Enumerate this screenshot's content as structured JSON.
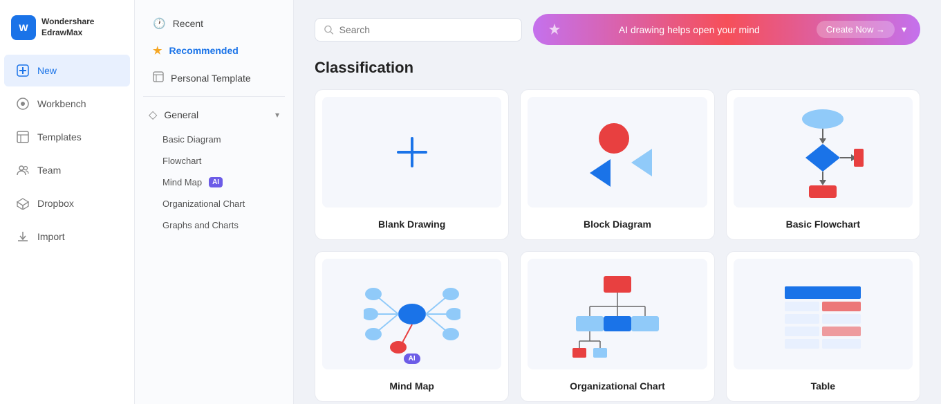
{
  "app": {
    "logo_letter": "W",
    "logo_line1": "Wondershare",
    "logo_line2": "EdrawMax"
  },
  "sidebar": {
    "items": [
      {
        "id": "new",
        "label": "New",
        "icon": "➕"
      },
      {
        "id": "workbench",
        "label": "Workbench",
        "icon": "☁"
      },
      {
        "id": "templates",
        "label": "Templates",
        "icon": "📋"
      },
      {
        "id": "team",
        "label": "Team",
        "icon": "👥"
      },
      {
        "id": "dropbox",
        "label": "Dropbox",
        "icon": "📦"
      },
      {
        "id": "import",
        "label": "Import",
        "icon": "⬇"
      }
    ]
  },
  "middle_panel": {
    "items": [
      {
        "id": "recent",
        "label": "Recent",
        "icon": "🕐",
        "active": false
      },
      {
        "id": "recommended",
        "label": "Recommended",
        "icon": "★",
        "active": true
      },
      {
        "id": "personal_template",
        "label": "Personal Template",
        "icon": "▭",
        "active": false
      }
    ],
    "sections": [
      {
        "id": "general",
        "label": "General",
        "icon": "◇",
        "expanded": true,
        "sub_items": [
          {
            "id": "basic_diagram",
            "label": "Basic Diagram",
            "ai": false
          },
          {
            "id": "flowchart",
            "label": "Flowchart",
            "ai": false
          },
          {
            "id": "mind_map",
            "label": "Mind Map",
            "ai": true
          },
          {
            "id": "org_chart",
            "label": "Organizational Chart",
            "ai": false
          },
          {
            "id": "graphs_charts",
            "label": "Graphs and Charts",
            "ai": false
          }
        ]
      }
    ]
  },
  "topbar": {
    "search_placeholder": "Search",
    "ai_banner_text": "AI drawing helps open your mind",
    "create_now_label": "Create Now →"
  },
  "main": {
    "section_title": "Classification",
    "cards": [
      {
        "id": "blank_drawing",
        "label": "Blank Drawing",
        "type": "blank",
        "ai": false
      },
      {
        "id": "block_diagram",
        "label": "Block Diagram",
        "type": "block",
        "ai": false
      },
      {
        "id": "basic_flowchart",
        "label": "Basic Flowchart",
        "type": "flowchart",
        "ai": false
      },
      {
        "id": "mind_map2",
        "label": "Mind Map",
        "type": "mindmap",
        "ai": true
      },
      {
        "id": "org_chart2",
        "label": "Organizational Chart",
        "type": "orgchart",
        "ai": false
      },
      {
        "id": "table",
        "label": "Table",
        "type": "table",
        "ai": false
      }
    ]
  },
  "colors": {
    "blue": "#1a73e8",
    "purple": "#6c5ce7",
    "accent": "#f5a623"
  }
}
